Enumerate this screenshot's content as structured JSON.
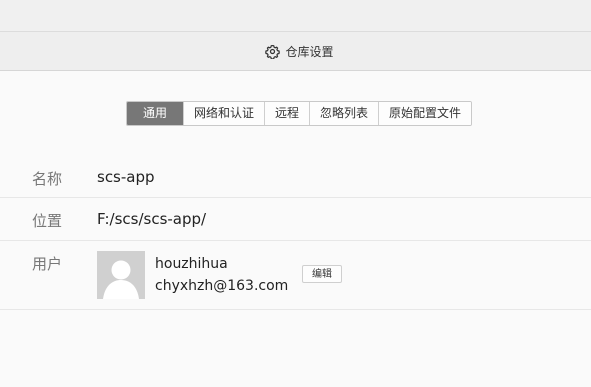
{
  "header": {
    "title": "仓库设置",
    "icon": "gear-icon"
  },
  "tabs": [
    {
      "label": "通用",
      "active": true
    },
    {
      "label": "网络和认证",
      "active": false
    },
    {
      "label": "远程",
      "active": false
    },
    {
      "label": "忽略列表",
      "active": false
    },
    {
      "label": "原始配置文件",
      "active": false
    }
  ],
  "fields": {
    "name": {
      "label": "名称",
      "value": "scs-app"
    },
    "location": {
      "label": "位置",
      "value": "F:/scs/scs-app/"
    },
    "user": {
      "label": "用户",
      "username": "houzhihua",
      "email": "chyxhzh@163.com",
      "edit_label": "编辑"
    }
  }
}
